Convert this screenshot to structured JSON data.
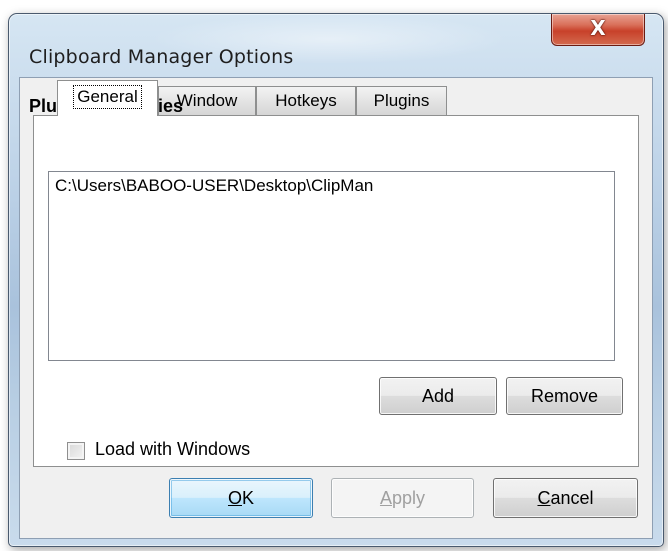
{
  "window": {
    "title": "Clipboard Manager Options",
    "close_icon": "close-icon",
    "close_glyph": "X"
  },
  "tabs": [
    {
      "label": "General",
      "active": true
    },
    {
      "label": "Window",
      "active": false
    },
    {
      "label": "Hotkeys",
      "active": false
    },
    {
      "label": "Plugins",
      "active": false
    }
  ],
  "plugins_panel": {
    "group_label": "Plugin Directories",
    "directories": [
      "C:\\Users\\BABOO-USER\\Desktop\\ClipMan"
    ],
    "add_label": "Add",
    "remove_label": "Remove"
  },
  "load_with_windows": {
    "label": "Load with Windows",
    "checked": false
  },
  "footer": {
    "ok_mnemonic": "O",
    "ok_rest": "K",
    "apply_mnemonic": "A",
    "apply_rest": "pply",
    "apply_enabled": false,
    "cancel_mnemonic": "C",
    "cancel_rest": "ancel"
  }
}
